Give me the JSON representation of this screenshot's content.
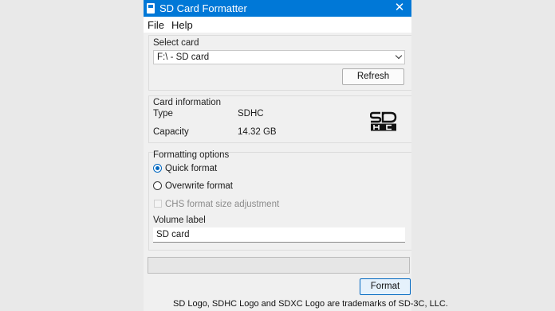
{
  "window": {
    "title": "SD Card Formatter",
    "close_glyph": "✕"
  },
  "menu": {
    "items": [
      "File",
      "Help"
    ]
  },
  "select_card": {
    "label": "Select card",
    "selected": "F:\\ - SD card",
    "refresh_label": "Refresh"
  },
  "card_info": {
    "label": "Card information",
    "type_key": "Type",
    "type_value": "SDHC",
    "capacity_key": "Capacity",
    "capacity_value": "14.32 GB"
  },
  "formatting": {
    "label": "Formatting options",
    "quick_format": "Quick format",
    "overwrite_format": "Overwrite format",
    "chs_adjustment": "CHS format size adjustment",
    "selected_option": "quick",
    "volume_label_title": "Volume label",
    "volume_label_value": "SD card"
  },
  "progress": {
    "fraction": 0
  },
  "actions": {
    "format_label": "Format"
  },
  "footer": {
    "trademark": "SD Logo, SDHC Logo and SDXC Logo are trademarks of SD-3C, LLC."
  },
  "colors": {
    "titlebar": "#0078d7",
    "accent": "#0067c0"
  }
}
